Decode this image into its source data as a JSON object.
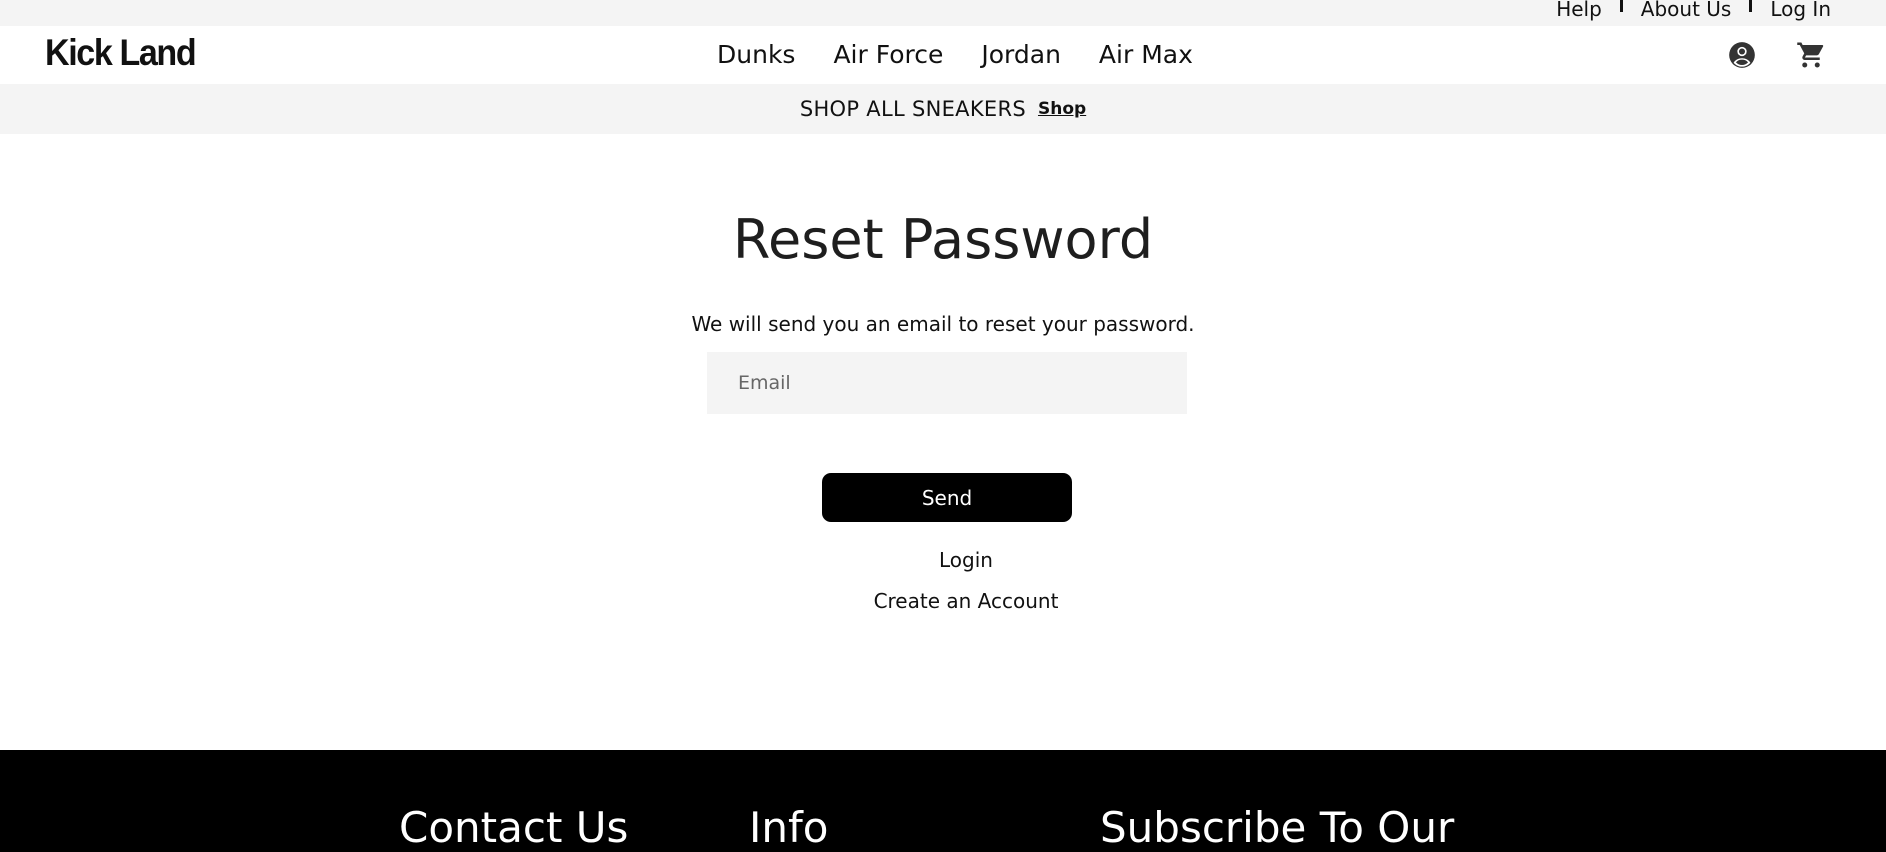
{
  "utility_nav": {
    "help": "Help",
    "about": "About Us",
    "login": "Log In"
  },
  "header": {
    "logo": "Kick Land",
    "nav": [
      "Dunks",
      "Air Force",
      "Jordan",
      "Air Max"
    ],
    "icons": [
      "account-circle-icon",
      "shopping-cart-icon"
    ]
  },
  "promo": {
    "text": "SHOP ALL SNEAKERS",
    "link": "Shop"
  },
  "reset": {
    "title": "Reset Password",
    "subtitle": "We will send you an email to reset your password.",
    "email_placeholder": "Email",
    "send_label": "Send",
    "login_link": "Login",
    "create_account_link": "Create an Account"
  },
  "footer": {
    "contact_heading": "Contact Us",
    "info_heading": "Info",
    "subscribe_heading": "Subscribe To Our"
  },
  "colors": {
    "bar_background": "#f4f4f4",
    "button": "#000000",
    "footer": "#000000",
    "icon": "#333333"
  }
}
